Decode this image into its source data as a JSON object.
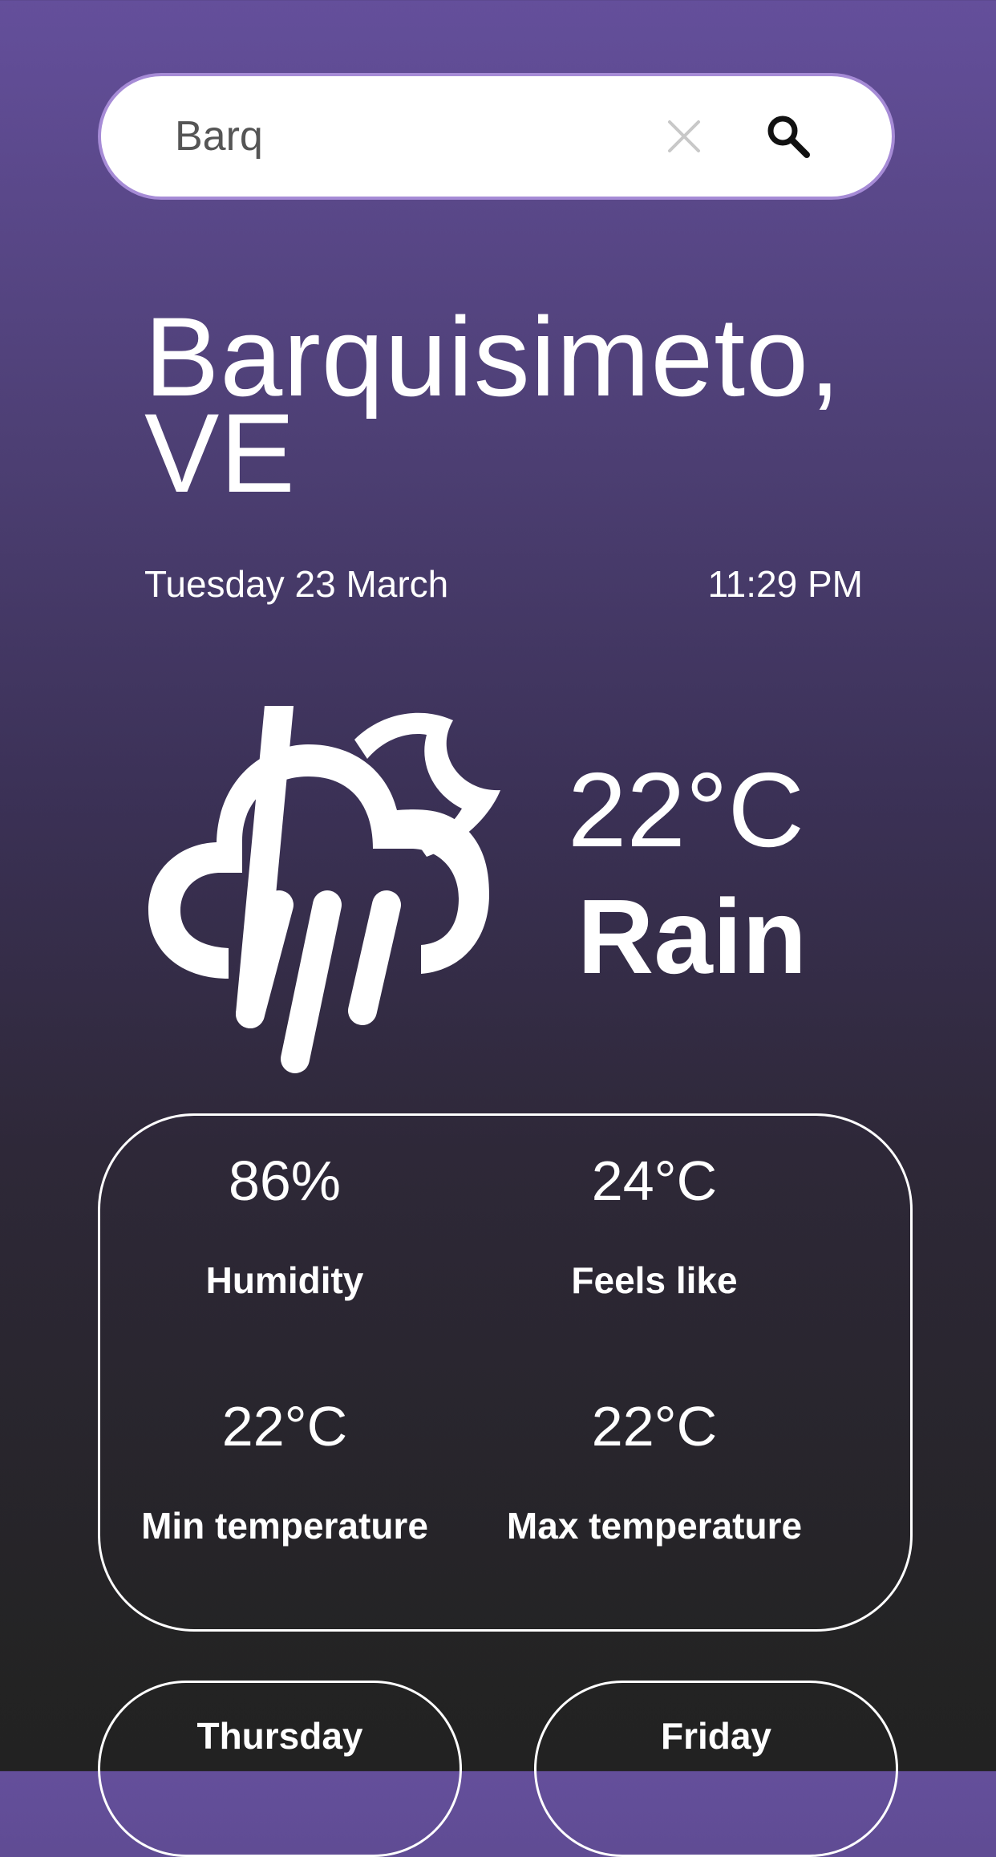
{
  "search": {
    "value": "Barq",
    "clear_icon": "close-icon",
    "search_icon": "search-icon"
  },
  "location": {
    "city": "Barquisimeto, VE",
    "date": "Tuesday 23 March",
    "time": "11:29 PM"
  },
  "current": {
    "icon": "cloud-moon-rain-icon",
    "temperature": "22°C",
    "condition": "Rain"
  },
  "details": [
    {
      "value": "86%",
      "label": "Humidity"
    },
    {
      "value": "24°C",
      "label": "Feels like"
    },
    {
      "value": "22°C",
      "label": "Min temperature"
    },
    {
      "value": "22°C",
      "label": "Max temperature"
    }
  ],
  "forecast": [
    {
      "day": "Thursday"
    },
    {
      "day": "Friday"
    }
  ],
  "colors": {
    "gradient_top": "#644f9b",
    "gradient_bottom": "#222222",
    "search_border": "#a68bd6",
    "text": "#ffffff"
  }
}
